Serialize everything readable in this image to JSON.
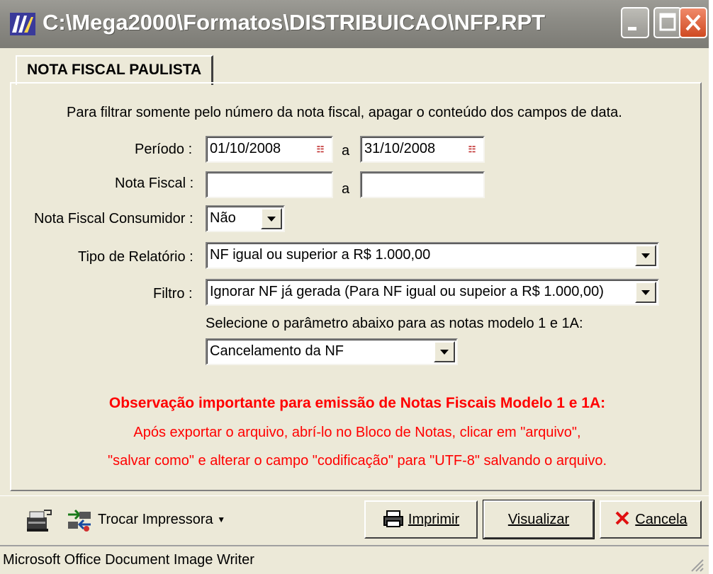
{
  "window": {
    "title": "C:\\Mega2000\\Formatos\\DISTRIBUICAO\\NFP.RPT"
  },
  "tab": {
    "label": "NOTA FISCAL PAULISTA"
  },
  "form": {
    "instruction": "Para filtrar somente pelo número da nota fiscal, apagar o conteúdo dos campos de data.",
    "periodo_label": "Período :",
    "periodo_from": "01/10/2008",
    "periodo_to": "31/10/2008",
    "a_label": "a",
    "nota_fiscal_label": "Nota Fiscal :",
    "nota_fiscal_from": "",
    "nota_fiscal_to": "",
    "consumidor_label": "Nota Fiscal Consumidor :",
    "consumidor_value": "Não",
    "tipo_label": "Tipo de Relatório :",
    "tipo_value": "NF igual ou superior a R$ 1.000,00",
    "filtro_label": "Filtro :",
    "filtro_value": "Ignorar NF já gerada (Para NF igual ou supeior a R$ 1.000,00)",
    "modelo_label": "Selecione o parâmetro abaixo para as notas modelo 1 e 1A:",
    "modelo_value": "Cancelamento da NF"
  },
  "observation": {
    "title": "Observação importante para emissão de Notas Fiscais Modelo 1 e 1A:",
    "line1": "Após exportar o arquivo, abrí-lo no Bloco de Notas, clicar em \"arquivo\",",
    "line2": "\"salvar como\" e alterar o campo \"codificação\" para \"UTF-8\" salvando o arquivo.",
    "color": "#ff0000"
  },
  "toolbar": {
    "trocar_label": "Trocar Impressora",
    "imprimir_label": "Imprimir",
    "visualizar_label": "Visualizar",
    "cancela_label": "Cancela"
  },
  "status": {
    "text": "Microsoft Office Document Image Writer"
  },
  "icons": [
    "app-icon",
    "minimize-icon",
    "maximize-icon",
    "close-icon",
    "calendar-icon",
    "printer-setup-icon",
    "swap-printer-icon",
    "printer-icon",
    "cancel-x-icon"
  ]
}
